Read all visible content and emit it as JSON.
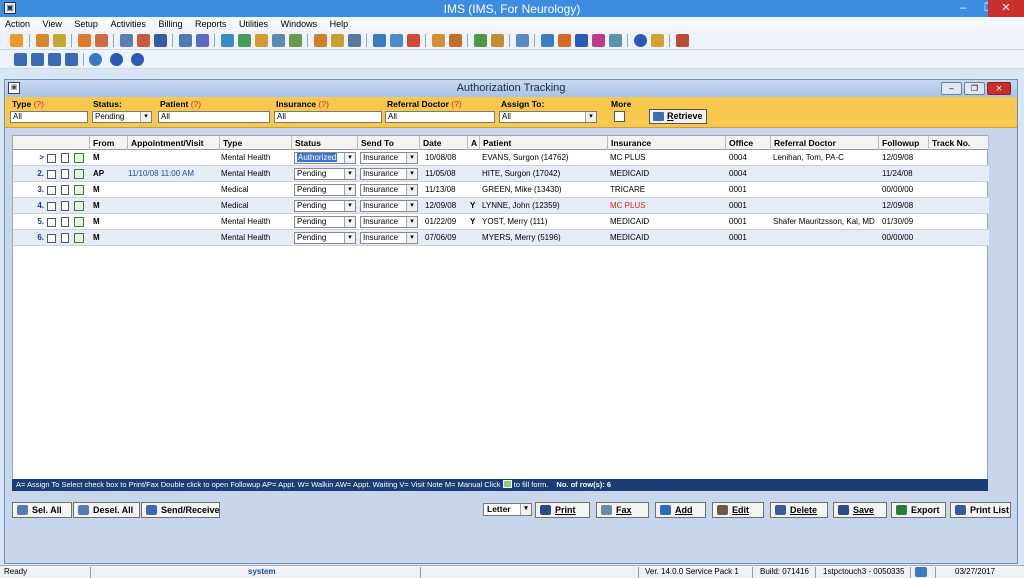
{
  "window": {
    "title": "IMS (IMS, For Neurology)",
    "min_glyph": "–",
    "max_glyph": "❐",
    "close_glyph": "✕"
  },
  "menu": [
    "Action",
    "View",
    "Setup",
    "Activities",
    "Billing",
    "Reports",
    "Utilities",
    "Windows",
    "Help"
  ],
  "child": {
    "title": "Authorization Tracking"
  },
  "filters": {
    "type_label": "Type",
    "type_q": "(?)",
    "type_value": "All",
    "status_label": "Status:",
    "status_value": "Pending",
    "patient_label": "Patient",
    "patient_q": "(?)",
    "patient_value": "All",
    "insurance_label": "Insurance",
    "insurance_q": "(?)",
    "insurance_value": "All",
    "referral_label": "Referral Doctor",
    "referral_q": "(?)",
    "referral_value": "All",
    "assign_label": "Assign To:",
    "assign_value": "All",
    "more_label": "More",
    "retrieve_label": "Retrieve",
    "retrieve_access_key": "R"
  },
  "columns": {
    "from": "From",
    "appt": "Appointment/Visit",
    "type": "Type",
    "status": "Status",
    "sendto": "Send To",
    "date": "Date",
    "a": "A",
    "patient": "Patient",
    "insurance": "Insurance",
    "office": "Office",
    "referral": "Referral Doctor",
    "followup": "Followup",
    "track": "Track No."
  },
  "rows": [
    {
      "num": ">",
      "from": "M",
      "appt": "",
      "type": "Mental Health",
      "status": "Authorized",
      "sendto": "Insurance",
      "date": "10/08/08",
      "a": "",
      "patient": "EVANS, Surgon  (14762)",
      "insurance": "MC PLUS",
      "insurance_red": false,
      "office": "0004",
      "referral": "Lenihan, Tom, PA-C",
      "followup": "12/09/08",
      "track": ""
    },
    {
      "num": "2.",
      "from": "AP",
      "appt": "11/10/08 11:00 AM",
      "type": "Mental Health",
      "status": "Pending",
      "sendto": "Insurance",
      "date": "11/05/08",
      "a": "",
      "patient": "HITE, Surgon  (17042)",
      "insurance": "MEDICAID",
      "insurance_red": false,
      "office": "0004",
      "referral": "",
      "followup": "11/24/08",
      "track": ""
    },
    {
      "num": "3.",
      "from": "M",
      "appt": "",
      "type": "Medical",
      "status": "Pending",
      "sendto": "Insurance",
      "date": "11/13/08",
      "a": "",
      "patient": "GREEN, Mike  (13430)",
      "insurance": "TRICARE",
      "insurance_red": false,
      "office": "0001",
      "referral": "",
      "followup": "00/00/00",
      "track": ""
    },
    {
      "num": "4.",
      "from": "M",
      "appt": "",
      "type": "Medical",
      "status": "Pending",
      "sendto": "Insurance",
      "date": "12/09/08",
      "a": "Y",
      "patient": "LYNNE, John  (12359)",
      "insurance": "MC PLUS",
      "insurance_red": true,
      "office": "0001",
      "referral": "",
      "followup": "12/09/08",
      "track": ""
    },
    {
      "num": "5.",
      "from": "M",
      "appt": "",
      "type": "Mental Health",
      "status": "Pending",
      "sendto": "Insurance",
      "date": "01/22/09",
      "a": "Y",
      "patient": "YOST, Merry  (111)",
      "insurance": "MEDICAID",
      "insurance_red": false,
      "office": "0001",
      "referral": "Shafer Mauritzsson, Kal, MD",
      "followup": "01/30/09",
      "track": ""
    },
    {
      "num": "6.",
      "from": "M",
      "appt": "",
      "type": "Mental Health",
      "status": "Pending",
      "sendto": "Insurance",
      "date": "07/06/09",
      "a": "",
      "patient": "MYERS, Merry  (5196)",
      "insurance": "MEDICAID",
      "insurance_red": false,
      "office": "0001",
      "referral": "",
      "followup": "00/00/00",
      "track": ""
    }
  ],
  "legend": {
    "text": "A= Assign To   Select check box to Print/Fax   Double click to open Followup   AP= Appt. W= Walkin  AW= Appt. Waiting  V= Visit Note  M= Manual   Click",
    "text2": "to fill form.",
    "rows_label": "No. of row(s): 6"
  },
  "buttons": {
    "sel_all": "Sel. All",
    "desel_all": "Desel. All",
    "send_receive": "Send/Receive",
    "paper": "Letter",
    "print": "Print",
    "fax": "Fax",
    "add": "Add",
    "edit": "Edit",
    "delete": "Delete",
    "save": "Save",
    "export": "Export",
    "print_list": "Print List"
  },
  "status": {
    "ready": "Ready",
    "user": "system",
    "version": "Ver. 14.0.0 Service Pack 1",
    "build": "Build: 071416",
    "server": "1stpctouch3 - 0050335",
    "date": "03/27/2017"
  },
  "colors": {
    "titlebar": "#3c8de2",
    "filter_bg": "#f8c84e",
    "legend_bg": "#1a3d78",
    "selection": "#3a74d0",
    "red_text": "#e02020"
  }
}
